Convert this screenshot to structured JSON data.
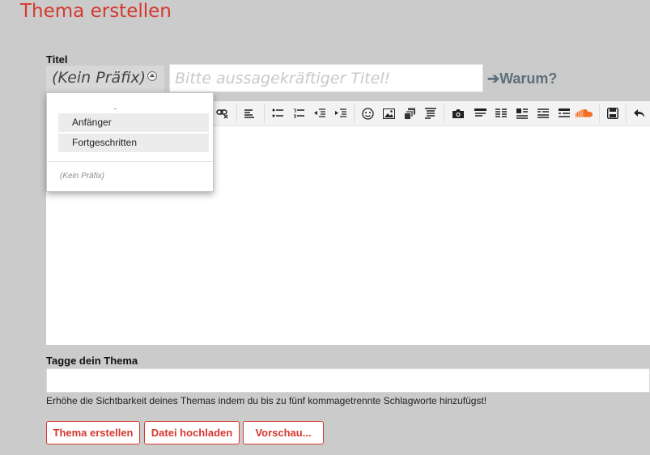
{
  "page": {
    "title": "Thema erstellen"
  },
  "form": {
    "title_label": "Titel",
    "prefix_selected": "(Kein Präfix)",
    "title_placeholder": "Bitte aussagekräftiger Titel!",
    "why_link": "➔Warum?",
    "tags_label": "Tagge dein Thema",
    "tags_hint": "Erhöhe die Sichtbarkeit deines Themas indem du bis zu fünf kommagetrennte Schlagworte hinzufügst!"
  },
  "prefix_menu": {
    "options": [
      "Anfänger",
      "Fortgeschritten"
    ],
    "none_option": "(Kein Präfix)"
  },
  "toolbar": {
    "icons": [
      "unlink-icon",
      "align-left-icon",
      "bullet-list-icon",
      "numbered-list-icon",
      "outdent-icon",
      "indent-icon",
      "smiley-icon",
      "image-icon",
      "media-icon",
      "quote-icon",
      "camera-icon",
      "code-icon",
      "php-icon",
      "html-icon",
      "spoiler-icon",
      "table-icon",
      "soundcloud-icon",
      "save-icon",
      "undo-icon"
    ]
  },
  "buttons": {
    "create": "Thema erstellen",
    "upload": "Datei hochladen",
    "preview": "Vorschau..."
  },
  "colors": {
    "accent": "#d6382f",
    "link": "#5d6f7c",
    "background": "#cbcbcb",
    "soundcloud": "#f26f23"
  }
}
